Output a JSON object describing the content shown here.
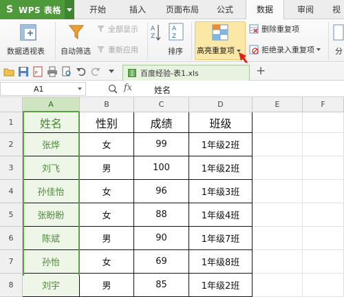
{
  "app": {
    "name": "WPS 表格",
    "logo": "S"
  },
  "menu_tabs": [
    "开始",
    "插入",
    "页面布局",
    "公式",
    "数据",
    "审阅",
    "视"
  ],
  "ribbon": {
    "pivot_label": "数据透视表",
    "autofilter_label": "自动筛选",
    "show_all_label": "全部显示",
    "reapply_label": "重新应用",
    "sort_label": "排序",
    "highlight_dup_label": "高亮重复项",
    "delete_dup_label": "删除重复项",
    "reject_dup_label": "拒绝录入重复项",
    "split_label": "分"
  },
  "doc_tab": {
    "title": "百度经验-表1.xls"
  },
  "formula_bar": {
    "cell_ref": "A1",
    "fx_label": "fx",
    "content": "姓名"
  },
  "sheet": {
    "columns": [
      "A",
      "B",
      "C",
      "D",
      "E",
      "F"
    ],
    "rows": [
      "1",
      "2",
      "3",
      "4",
      "5",
      "6",
      "7",
      "8"
    ],
    "header": [
      "姓名",
      "性别",
      "成绩",
      "班级"
    ],
    "data": [
      [
        "张烨",
        "女",
        "99",
        "1年级2班"
      ],
      [
        "刘飞",
        "男",
        "100",
        "1年级2班"
      ],
      [
        "孙佳怡",
        "女",
        "96",
        "1年级3班"
      ],
      [
        "张盼盼",
        "女",
        "88",
        "1年级4班"
      ],
      [
        "陈斌",
        "男",
        "90",
        "1年级7班"
      ],
      [
        "孙怡",
        "女",
        "69",
        "1年级8班"
      ],
      [
        "刘宇",
        "男",
        "85",
        "1年级2班"
      ]
    ]
  },
  "colors": {
    "brand_green": "#4e9a3a",
    "highlight_button": "#fbe7a6",
    "selection_fill": "#eef6e8",
    "selection_text": "#4a8a38",
    "arrow_red": "#e02020"
  },
  "icons": [
    "pivot-table-icon",
    "filter-icon",
    "sort-icon",
    "highlight-duplicates-icon",
    "delete-duplicates-icon",
    "reject-duplicates-icon",
    "red-arrow-annotation"
  ]
}
